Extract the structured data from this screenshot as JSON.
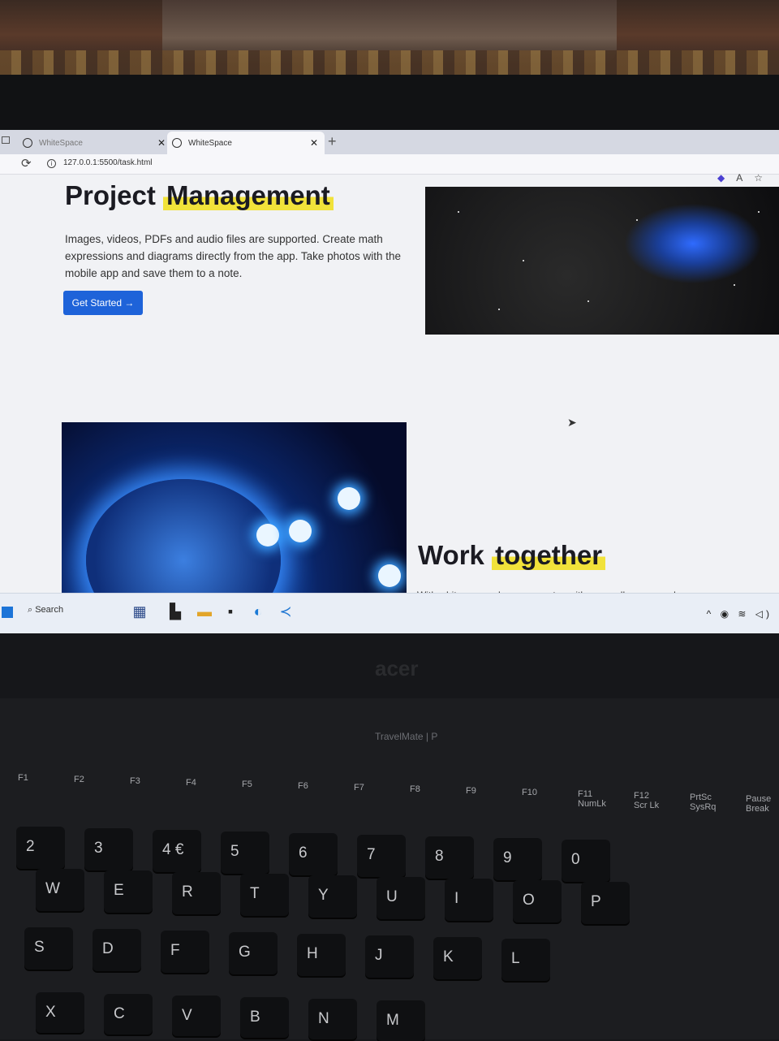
{
  "browser": {
    "tabs": [
      {
        "label": "WhiteSpace",
        "active": false
      },
      {
        "label": "WhiteSpace",
        "active": true
      }
    ],
    "new_tab": "+",
    "url": "127.0.0.1:5500/task.html"
  },
  "page": {
    "hero": {
      "title_plain": "Project",
      "title_highlight": "Management",
      "description": "Images, videos, PDFs and audio files are supported. Create math expressions and diagrams directly from the app. Take photos with the mobile app and save them to a note.",
      "cta_label": "Get Started →"
    },
    "section2": {
      "title_plain": "Work",
      "title_highlight": "together",
      "description": "With whitespace, share your notes with your colleagues and"
    }
  },
  "taskbar": {
    "search_label": "Search"
  },
  "laptop": {
    "brand": "acer",
    "model": "TravelMate | P",
    "fkeys": [
      "F1",
      "F2",
      "F3",
      "F4",
      "F5",
      "F6",
      "F7",
      "F8",
      "F9",
      "F10",
      "F11",
      "F12",
      "PrtSc",
      "Pause"
    ],
    "fkey_sub": [
      "",
      "",
      "",
      "",
      "",
      "",
      "",
      "",
      "",
      "",
      "NumLk",
      "Scr Lk",
      "SysRq",
      "Break"
    ],
    "keys_row1": [
      "2",
      "3",
      "4 €",
      "5",
      "6",
      "7",
      "8",
      "9",
      "0"
    ],
    "keys_row2": [
      "W",
      "E",
      "R",
      "T",
      "Y",
      "U",
      "I",
      "O",
      "P"
    ],
    "keys_row3": [
      "S",
      "D",
      "F",
      "G",
      "H",
      "J",
      "K",
      "L"
    ],
    "keys_row4": [
      "X",
      "C",
      "V",
      "B",
      "N",
      "M"
    ]
  },
  "colors": {
    "accent": "#1e63d9",
    "highlight": "#f1e23a"
  }
}
